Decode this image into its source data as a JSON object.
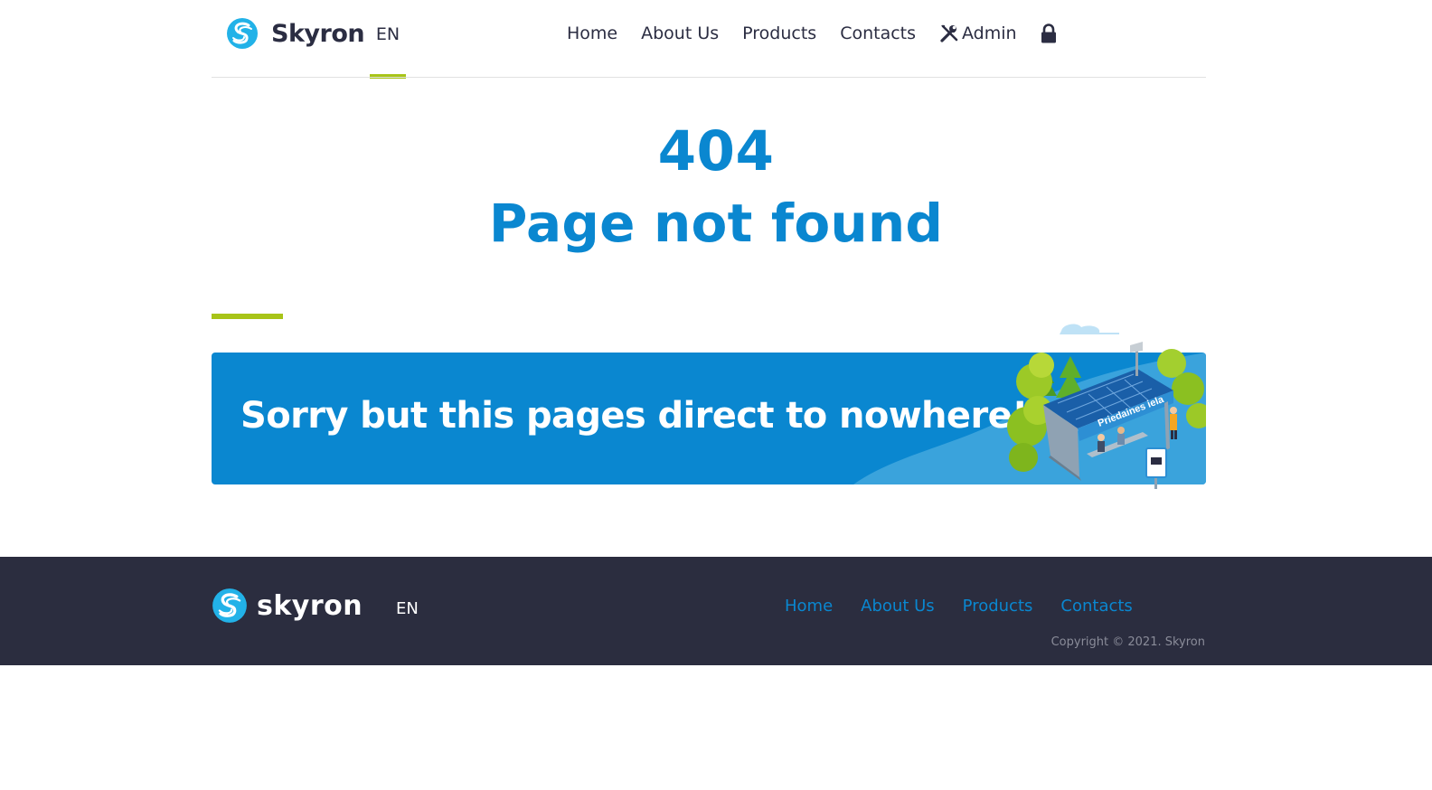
{
  "header": {
    "brand": "Skyron",
    "language": "EN",
    "nav": [
      "Home",
      "About Us",
      "Products",
      "Contacts"
    ],
    "admin_label": "Admin",
    "icons": {
      "logo": "skyron-logo-icon",
      "admin": "wrench-screwdriver-icon",
      "lock": "lock-icon"
    }
  },
  "error": {
    "code": "404",
    "title": "Page not found"
  },
  "banner": {
    "message": "Sorry but this pages direct to nowhere!",
    "sign_text": "Priedaines iela"
  },
  "footer": {
    "brand": "skyron",
    "language": "EN",
    "nav": [
      "Home",
      "About Us",
      "Products",
      "Contacts"
    ],
    "copyright": "Copyright © 2021. Skyron"
  },
  "colors": {
    "primary": "#0a87d0",
    "accent": "#a8c418",
    "dark": "#2b2d42",
    "footer_bg": "#2b2d3f",
    "white": "#ffffff"
  }
}
